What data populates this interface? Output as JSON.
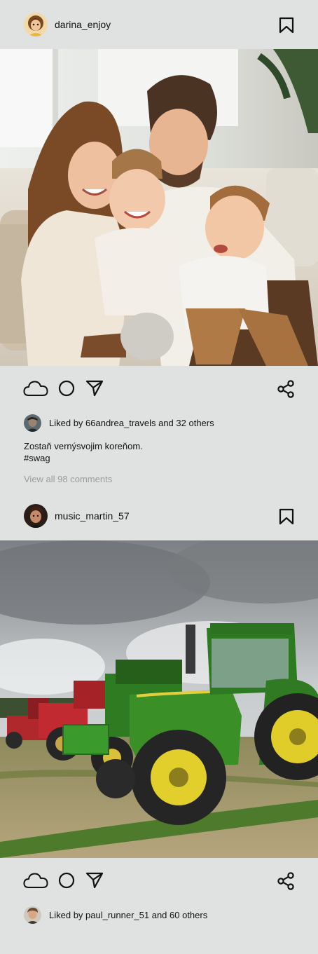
{
  "posts": [
    {
      "username": "darina_enjoy",
      "image_alt": "Family with two toddlers smiling on a sofa",
      "liked_by": "Liked by 66andrea_travels and 32 others",
      "caption_line1": "Zostaň vernýsvojim koreňom.",
      "caption_line2": "#swag",
      "view_comments": "View all 98 comments"
    },
    {
      "username": "music_martin_57",
      "image_alt": "Row of green and red tractors in a field under cloudy sky",
      "liked_by": "Liked by paul_runner_51 and 60 others"
    }
  ],
  "icons": {
    "like": "cloud-icon",
    "comment": "circle-icon",
    "send": "send-icon",
    "share": "share-icon",
    "bookmark": "bookmark-icon"
  },
  "colors": {
    "background": "#e0e2e1",
    "muted_text": "#9a9c9b",
    "text": "#111111"
  }
}
